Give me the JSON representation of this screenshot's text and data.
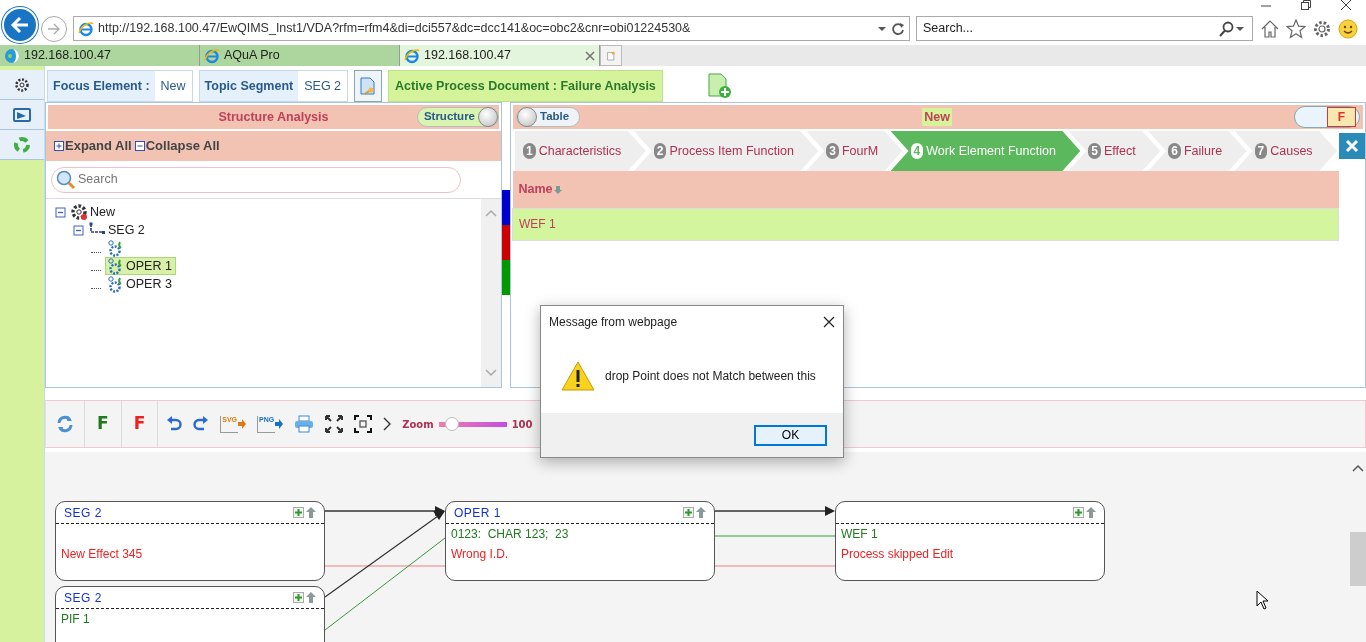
{
  "browser": {
    "address": "http://192.168.100.47/EwQIMS_Inst1/VDA?rfm=rfm4&di=dci557&dc=dcc141&oc=obc2&cnr=obi01224530&",
    "search_placeholder": "Search...",
    "tabs": [
      {
        "label": "192.168.100.47",
        "kind": "app",
        "selected": false
      },
      {
        "label": "AQuA Pro",
        "kind": "browser",
        "selected": false
      },
      {
        "label": "192.168.100.47",
        "kind": "browser",
        "selected": true
      }
    ]
  },
  "header": {
    "focus_label": "Focus Element :",
    "focus_value": "New",
    "topic_label": "Topic Segment",
    "topic_value": "SEG 2",
    "active_document": "Active Process Document : Failure Analysis"
  },
  "structure": {
    "title": "Structure Analysis",
    "toggle": {
      "label": "Structure",
      "on": true
    },
    "expand": "Expand All",
    "collapse": "Collapse All",
    "search_placeholder": "Search",
    "tree": [
      {
        "label": "New",
        "kind": "root",
        "expanded": true,
        "selected": false,
        "children": [
          {
            "label": "SEG 2",
            "kind": "segment",
            "expanded": true,
            "selected": false,
            "children": [
              {
                "kind": "operation",
                "selected": false
              },
              {
                "label": "OPER 1",
                "kind": "operation",
                "selected": true
              },
              {
                "label": "OPER 3",
                "kind": "operation",
                "selected": false
              }
            ]
          }
        ]
      }
    ]
  },
  "functions": {
    "toggle": {
      "label": "Table",
      "on": false
    },
    "title": "New",
    "switch": {
      "label": "F",
      "on": true
    },
    "steps": [
      {
        "number": "1",
        "label": "Characteristics",
        "selected": false
      },
      {
        "number": "2",
        "label": "Process Item Function",
        "selected": false
      },
      {
        "number": "3",
        "label": "FourM",
        "selected": false
      },
      {
        "number": "4",
        "label": "Work Element Function",
        "selected": true
      },
      {
        "number": "5",
        "label": "Effect",
        "selected": false
      },
      {
        "number": "6",
        "label": "Failure",
        "selected": false
      },
      {
        "number": "7",
        "label": "Causes",
        "selected": false
      }
    ],
    "table": {
      "columns": [
        "Name"
      ],
      "rows": [
        [
          "WEF 1"
        ]
      ]
    }
  },
  "toolbar": {
    "function_filter": "F",
    "failure_filter": "F",
    "exports": [
      "SVG",
      "PNG"
    ],
    "zoom_label": "Zoom",
    "zoom": {
      "level": 0.2
    },
    "zoom_value": "100"
  },
  "diagram": {
    "nodes": [
      {
        "title": "SEG 2",
        "failure": "New Effect 345"
      },
      {
        "title": "SEG 2",
        "function": "PIF 1"
      },
      {
        "title": "OPER 1",
        "function": "0123:  CHAR 123;  23",
        "failure": "Wrong I.D."
      },
      {
        "function": "WEF 1",
        "failure": "Process skipped Edit"
      }
    ]
  },
  "dialog": {
    "title": "Message from webpage",
    "message": "drop Point does not Match between this",
    "button": "OK"
  }
}
